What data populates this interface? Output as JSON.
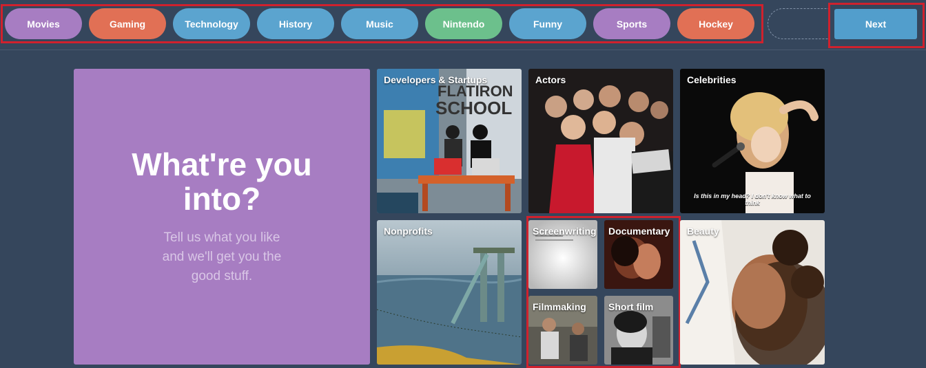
{
  "tags": [
    {
      "label": "Movies",
      "color": "#a77dc2"
    },
    {
      "label": "Gaming",
      "color": "#e17055"
    },
    {
      "label": "Technology",
      "color": "#5ba4cf"
    },
    {
      "label": "History",
      "color": "#5ba4cf"
    },
    {
      "label": "Music",
      "color": "#5ba4cf"
    },
    {
      "label": "Nintendo",
      "color": "#6cc08c"
    },
    {
      "label": "Funny",
      "color": "#5ba4cf"
    },
    {
      "label": "Sports",
      "color": "#a77dc2"
    },
    {
      "label": "Hockey",
      "color": "#e17055"
    }
  ],
  "next_label": "Next",
  "intro": {
    "title": "What're you into?",
    "subtitle": "Tell us what you like and we'll get you the good stuff."
  },
  "tiles": {
    "developers": "Developers & Startups",
    "actors": "Actors",
    "celebrities": "Celebrities",
    "celebrities_caption": "Is this in my head? I don't know what to think",
    "nonprofits": "Nonprofits",
    "screenwriting": "Screenwriting",
    "documentary": "Documentary",
    "filmmaking": "Filmmaking",
    "short_film": "Short film",
    "beauty": "Beauty"
  },
  "colors": {
    "background": "#35465c",
    "accent": "#529ecc",
    "highlight": "#d0212d",
    "intro_card": "#a77dc2"
  }
}
